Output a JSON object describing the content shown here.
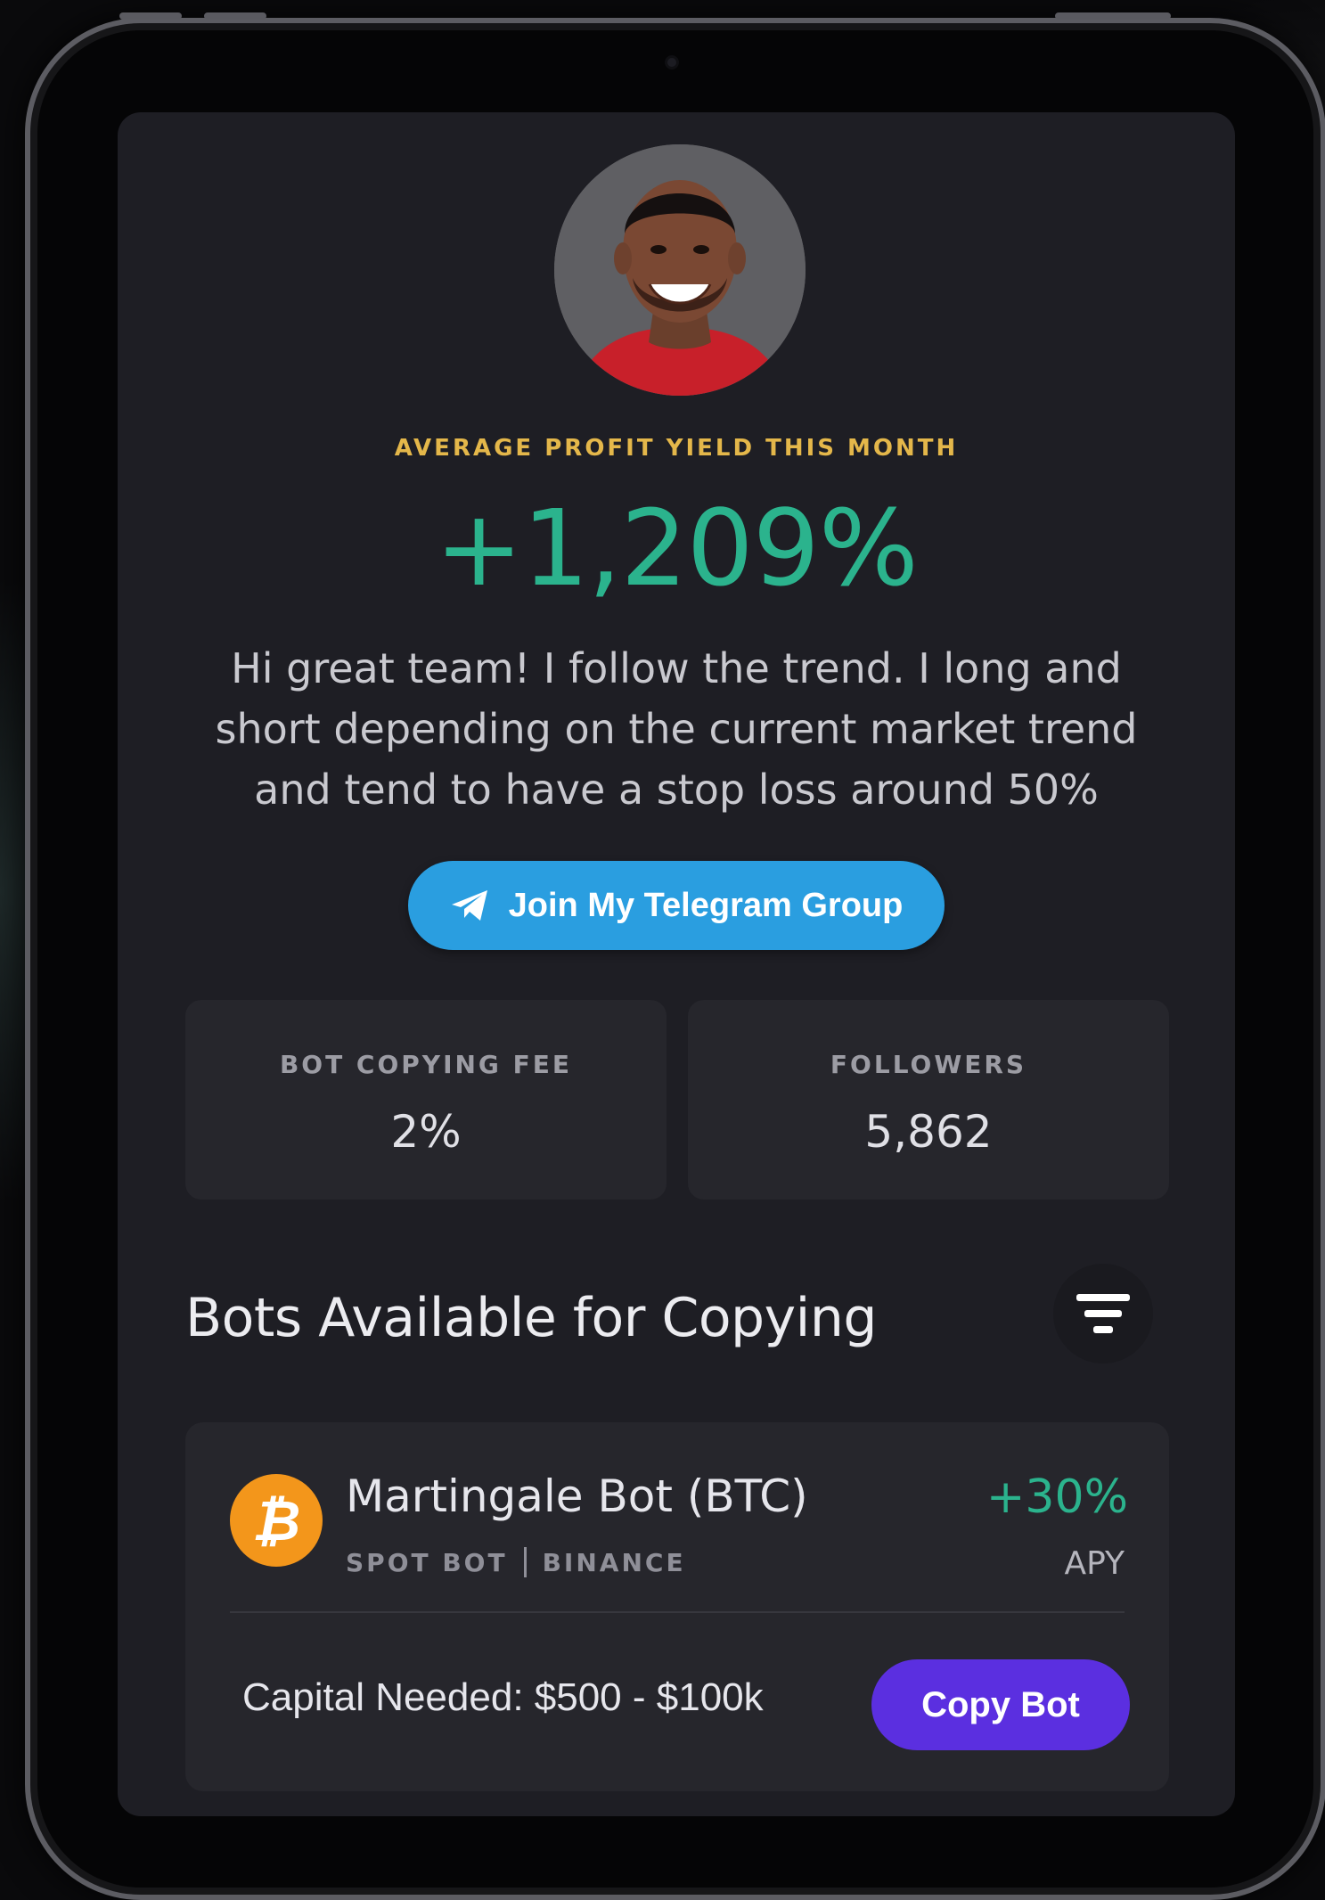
{
  "profile": {
    "eyebrow": "AVERAGE PROFIT YIELD THIS MONTH",
    "yield": "+1,209%",
    "bio_lines": [
      "Hi great team! I follow the trend. I long and",
      "short depending on the current market trend",
      "and tend to have a stop loss around 50%"
    ],
    "telegram_button": "Join My Telegram Group"
  },
  "stats": {
    "fee": {
      "label": "BOT COPYING FEE",
      "value": "2%"
    },
    "followers": {
      "label": "FOLLOWERS",
      "value": "5,862"
    }
  },
  "bots_section": {
    "title": "Bots Available for Copying",
    "filter_icon": "filter-lines-icon"
  },
  "bot": {
    "coin_symbol": "₿",
    "coin_color": "#f3961b",
    "name": "Martingale Bot (BTC)",
    "type": "SPOT BOT",
    "exchange": "BINANCE",
    "apy_value": "+30%",
    "apy_label": "APY",
    "capital": "Capital Needed: $500 - $100k",
    "copy_button": "Copy Bot"
  },
  "colors": {
    "accent_gold": "#e4b74a",
    "profit_green": "#2bb38d",
    "telegram_blue": "#2a9ee0",
    "copy_purple": "#5b2fe0"
  }
}
